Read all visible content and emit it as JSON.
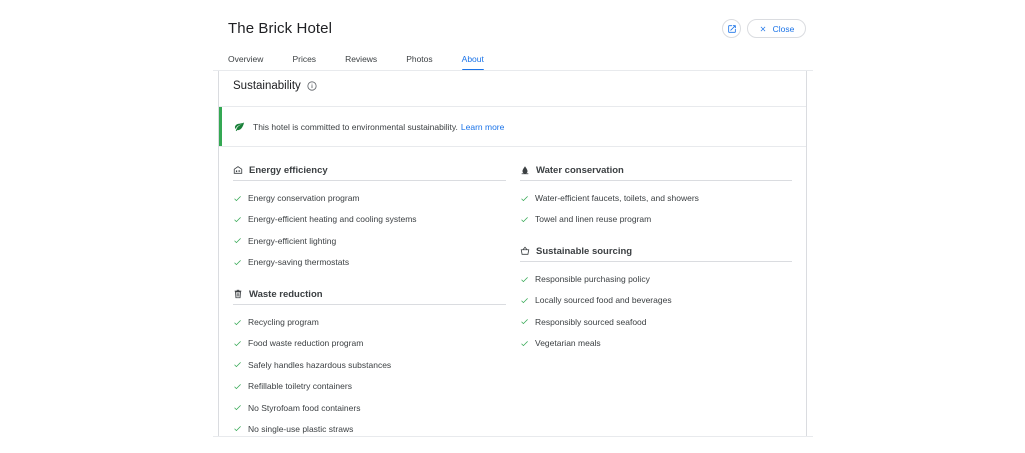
{
  "header": {
    "title": "The Brick Hotel",
    "close_label": "Close"
  },
  "tabs": [
    {
      "label": "Overview",
      "active": false
    },
    {
      "label": "Prices",
      "active": false
    },
    {
      "label": "Reviews",
      "active": false
    },
    {
      "label": "Photos",
      "active": false
    },
    {
      "label": "About",
      "active": true
    }
  ],
  "sustainability": {
    "title": "Sustainability",
    "banner_text": "This hotel is committed to environmental sustainability.",
    "learn_more": "Learn more"
  },
  "groups": {
    "energy": {
      "title": "Energy efficiency",
      "icon": "house-energy-icon",
      "items": [
        "Energy conservation program",
        "Energy-efficient heating and cooling systems",
        "Energy-efficient lighting",
        "Energy-saving thermostats"
      ]
    },
    "waste": {
      "title": "Waste reduction",
      "icon": "trash-icon",
      "items": [
        "Recycling program",
        "Food waste reduction program",
        "Safely handles hazardous substances",
        "Refillable toiletry containers",
        "No Styrofoam food containers",
        "No single-use plastic straws"
      ]
    },
    "water": {
      "title": "Water conservation",
      "icon": "water-drop-icon",
      "items": [
        "Water-efficient faucets, toilets, and showers",
        "Towel and linen reuse program"
      ]
    },
    "sourcing": {
      "title": "Sustainable sourcing",
      "icon": "basket-icon",
      "items": [
        "Responsible purchasing policy",
        "Locally sourced food and beverages",
        "Responsibly sourced seafood",
        "Vegetarian meals"
      ]
    }
  },
  "colors": {
    "accent": "#1a73e8",
    "check": "#34a853",
    "text": "#3c4043"
  }
}
